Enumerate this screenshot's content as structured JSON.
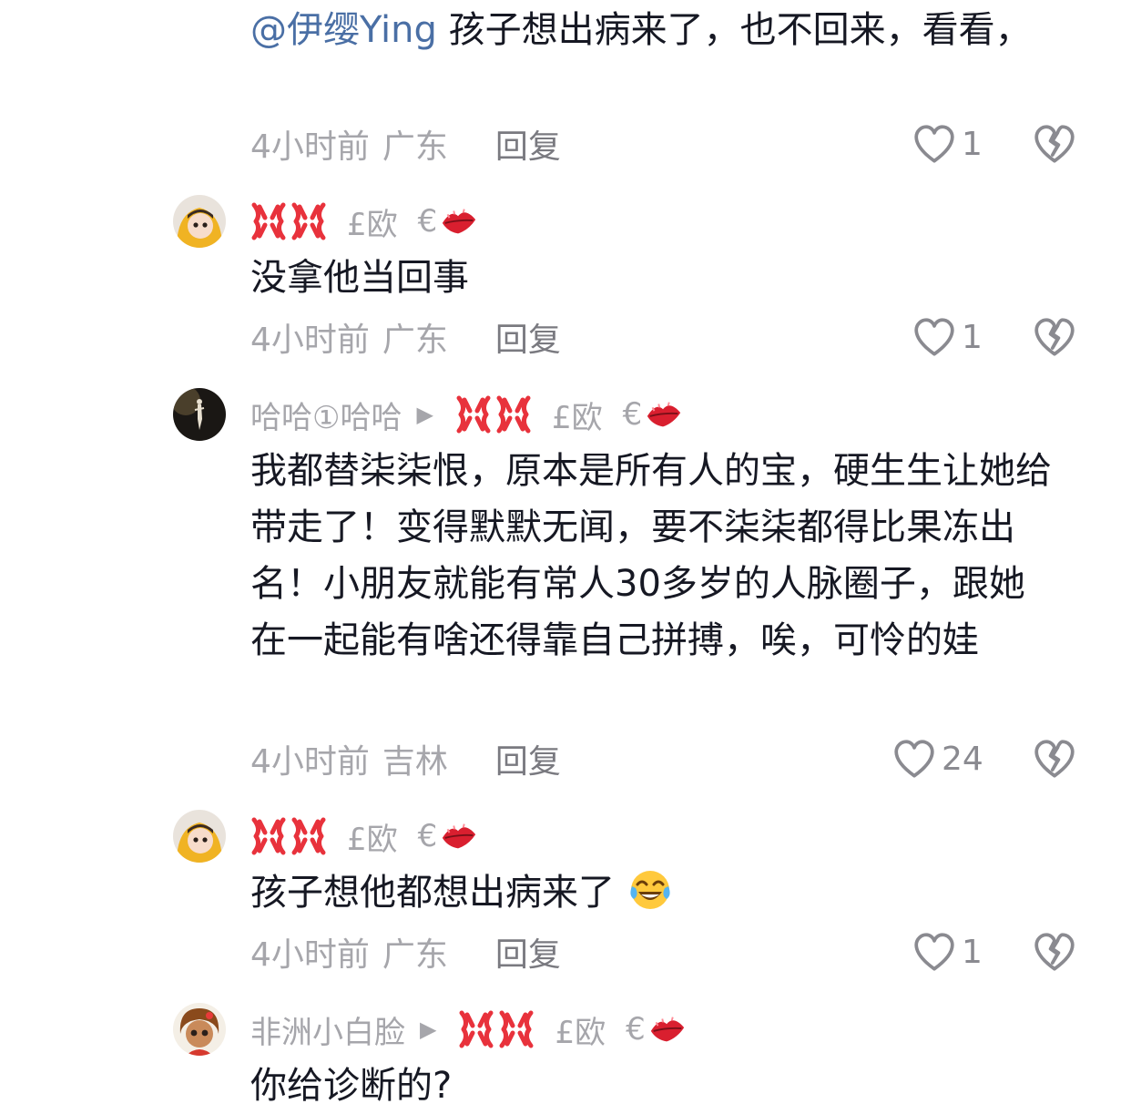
{
  "comments": [
    {
      "text_mention": "@伊缨Ying",
      "text": " 孩子想出病来了，也不回来，看看，",
      "time": "4小时前",
      "location": "广东",
      "reply_label": "回复",
      "likes": "1"
    },
    {
      "nickname_sym1": "£欧",
      "nickname_sym2": "€",
      "text": "没拿他当回事",
      "time": "4小时前",
      "location": "广东",
      "reply_label": "回复",
      "likes": "1"
    },
    {
      "username": "哈哈①哈哈",
      "nickname_sym1": "£欧",
      "nickname_sym2": "€",
      "text": "我都替柒柒恨，原本是所有人的宝，硬生生让她给带走了！变得默默无闻，要不柒柒都得比果冻出名！小朋友就能有常人30多岁的人脉圈子，跟她在一起能有啥还得靠自己拼搏，唉，可怜的娃",
      "time": "4小时前",
      "location": "吉林",
      "reply_label": "回复",
      "likes": "24"
    },
    {
      "nickname_sym1": "£欧",
      "nickname_sym2": "€",
      "text": "孩子想他都想出病来了",
      "time": "4小时前",
      "location": "广东",
      "reply_label": "回复",
      "likes": "1"
    },
    {
      "username": "非洲小白脸",
      "nickname_sym1": "£欧",
      "nickname_sym2": "€",
      "text": "你给诊断的?"
    }
  ],
  "icons": {
    "like": "heart-outline-icon",
    "dislike": "broken-heart-icon",
    "angry": "anger-symbol-emoji",
    "lips": "kiss-mark-emoji",
    "laugh": "tears-of-joy-emoji",
    "arrow": "play-triangle-icon"
  },
  "colors": {
    "text": "#161823",
    "secondary": "#a6a6ab",
    "mention": "#4a6fa5",
    "anger": "#e8323c",
    "lips": "#d91f2f"
  }
}
